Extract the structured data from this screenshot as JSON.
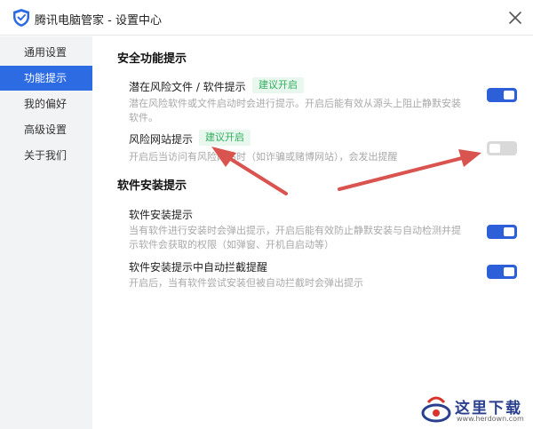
{
  "window": {
    "title": "腾讯电脑管家 - 设置中心",
    "logo_icon": "shield-icon",
    "close_icon": "close-icon"
  },
  "sidebar": {
    "items": [
      {
        "label": "通用设置",
        "active": false
      },
      {
        "label": "功能提示",
        "active": true
      },
      {
        "label": "我的偏好",
        "active": false
      },
      {
        "label": "高级设置",
        "active": false
      },
      {
        "label": "关于我们",
        "active": false
      }
    ]
  },
  "sections": {
    "security": {
      "title": "安全功能提示",
      "items": [
        {
          "title": "潜在风险文件 / 软件提示",
          "badge": "建议开启",
          "desc": "潜在风险软件或文件启动时会进行提示。开启后能有效从源头上阻止静默安装软件。",
          "enabled": true
        },
        {
          "title": "风险网站提示",
          "badge": "建议开启",
          "desc": "开启后当访问有风险网站时（如诈骗或赌博网站），会发出提醒",
          "enabled": false
        }
      ]
    },
    "install": {
      "title": "软件安装提示",
      "items": [
        {
          "title": "软件安装提示",
          "desc": "当有软件进行安装时会弹出提示，开启后能有效防止静默安装与自动检测并提示软件会获取的权限（如弹窗、开机自启动等）",
          "enabled": true
        },
        {
          "title": "软件安装提示中自动拦截提醒",
          "desc": "开启后，当有软件尝试安装但被自动拦截时会弹出提示",
          "enabled": true
        }
      ]
    }
  },
  "colors": {
    "accent": "#2d6be3",
    "toggle_on": "#2d5fd8",
    "badge_green": "#2fae5e",
    "annotation_red": "#d9534f"
  },
  "watermark": {
    "text": "这里下载",
    "sub": "www.herdown.com"
  }
}
